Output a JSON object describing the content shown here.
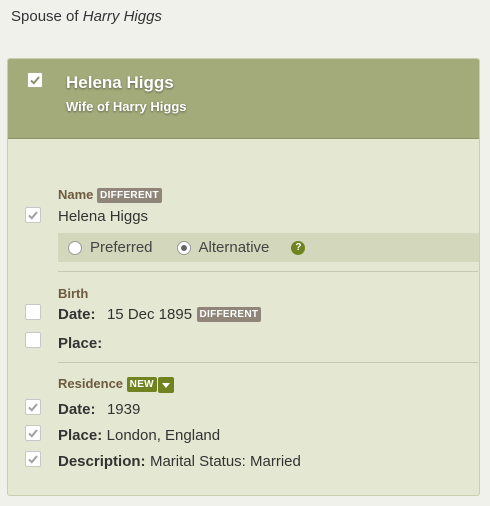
{
  "header": {
    "prefix": "Spouse of",
    "spouse_name": "Harry Higgs"
  },
  "card": {
    "title": "Helena Higgs",
    "subtitle": "Wife of Harry Higgs",
    "name_section": {
      "label": "Name",
      "badge": "DIFFERENT",
      "value": "Helena Higgs",
      "options": [
        "Preferred",
        "Alternative"
      ],
      "selected": "Alternative",
      "help": "?"
    },
    "birth": {
      "label": "Birth",
      "date_key": "Date:",
      "date_value": "15 Dec 1895",
      "date_badge": "DIFFERENT",
      "place_key": "Place:",
      "place_value": ""
    },
    "residence": {
      "label": "Residence",
      "badge": "NEW",
      "date_key": "Date:",
      "date_value": "1939",
      "place_key": "Place:",
      "place_value": "London, England",
      "desc_key": "Description:",
      "desc_value": "Marital Status: Married"
    }
  },
  "colors": {
    "header_bg": "#a3ab7b",
    "card_bg": "#e4e8d2",
    "new_badge": "#6f8420",
    "diff_badge": "#8f8679"
  }
}
